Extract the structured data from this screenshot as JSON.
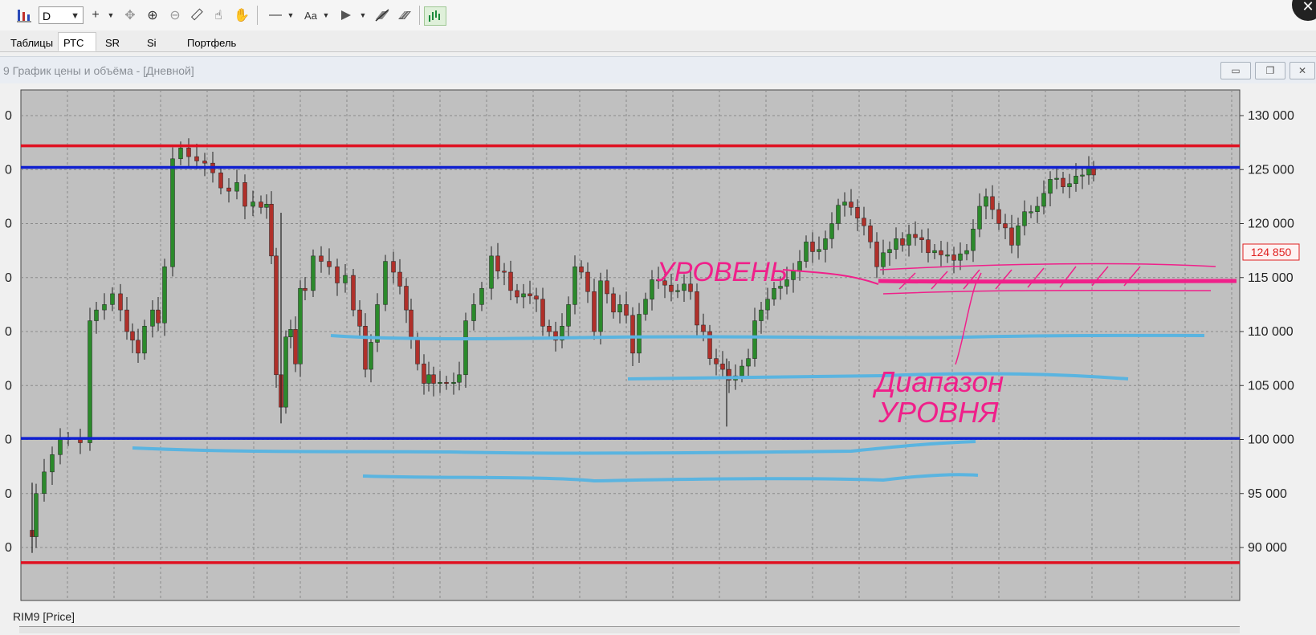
{
  "toolbar": {
    "period_value": "D",
    "buttons": [
      {
        "name": "chart-type-icon",
        "glyph": "▮"
      },
      {
        "name": "crosshair-icon",
        "glyph": "+"
      },
      {
        "name": "move-icon",
        "glyph": "✥"
      },
      {
        "name": "zoom-in-icon",
        "glyph": "⊕"
      },
      {
        "name": "zoom-out-icon",
        "glyph": "⊖"
      },
      {
        "name": "ruler-icon",
        "glyph": "📏"
      },
      {
        "name": "hand-cursor-icon",
        "glyph": "☝"
      },
      {
        "name": "pan-hand-icon",
        "glyph": "✋"
      },
      {
        "name": "line-tool-icon",
        "glyph": "—"
      },
      {
        "name": "text-tool-icon",
        "glyph": "Aa"
      },
      {
        "name": "marker-icon",
        "glyph": "◆"
      },
      {
        "name": "eraser-icon",
        "glyph": "⌫"
      },
      {
        "name": "clear-drawings-icon",
        "glyph": "▦"
      },
      {
        "name": "indicator-icon",
        "glyph": "▟"
      }
    ]
  },
  "tabs": [
    {
      "label": "Таблицы",
      "active": false
    },
    {
      "label": "РТС",
      "active": true
    },
    {
      "label": "SR",
      "active": false
    },
    {
      "label": "Si",
      "active": false
    },
    {
      "label": "Портфель",
      "active": false
    }
  ],
  "window": {
    "title": "9 График цены и объёма - [Дневной]",
    "minimize": "▭",
    "maximize": "❐",
    "close": "✕"
  },
  "chart": {
    "instrument_label": "RIM9 [Price]",
    "current_price_label": "124 850",
    "y_ticks": [
      "130 000",
      "125 000",
      "120 000",
      "115 000",
      "110 000",
      "105 000",
      "100 000",
      "95 000",
      "90 000"
    ],
    "left_tick_fragments": [
      "0",
      "0",
      "0",
      "0",
      "0",
      "0",
      "0",
      "0",
      "0"
    ],
    "annotations": {
      "level_text": "УРОВЕНЬ",
      "range_text_line1": "Диапазон",
      "range_text_line2": "УРОВНЯ"
    },
    "colors": {
      "red_level": "#e01020",
      "blue_level": "#1020d0",
      "light_blue_level": "#5ab4e0",
      "annotation": "#f0208a",
      "price_tag": "#e02020",
      "plot_bg": "#c0c0c0",
      "bull_candle": "#2b8a2b",
      "bear_candle": "#b0302a"
    }
  },
  "chart_data": {
    "type": "candlestick",
    "title": "",
    "ylim": [
      87000,
      131000
    ],
    "y_ticks": [
      90000,
      95000,
      100000,
      105000,
      110000,
      115000,
      120000,
      125000,
      130000
    ],
    "current_price": 124850,
    "horizontal_levels": [
      {
        "value": 127200,
        "color": "red"
      },
      {
        "value": 125200,
        "color": "blue"
      },
      {
        "value": 100100,
        "color": "blue"
      },
      {
        "value": 88600,
        "color": "red"
      }
    ],
    "candles_close_trace": [
      [
        40,
        91000
      ],
      [
        45,
        95000
      ],
      [
        55,
        97000
      ],
      [
        65,
        98600
      ],
      [
        75,
        100000
      ],
      [
        85,
        100100
      ],
      [
        100,
        99700
      ],
      [
        112,
        111000
      ],
      [
        120,
        112000
      ],
      [
        130,
        112500
      ],
      [
        140,
        113500
      ],
      [
        150,
        112000
      ],
      [
        158,
        110000
      ],
      [
        165,
        109200
      ],
      [
        172,
        108000
      ],
      [
        180,
        110500
      ],
      [
        190,
        112000
      ],
      [
        197,
        110800
      ],
      [
        205,
        116000
      ],
      [
        215,
        126000
      ],
      [
        225,
        127000
      ],
      [
        235,
        126200
      ],
      [
        245,
        125800
      ],
      [
        255,
        125600
      ],
      [
        265,
        124700
      ],
      [
        275,
        123300
      ],
      [
        285,
        123000
      ],
      [
        295,
        123800
      ],
      [
        305,
        121600
      ],
      [
        315,
        122000
      ],
      [
        325,
        121500
      ],
      [
        332,
        121800
      ],
      [
        338,
        117000
      ],
      [
        344,
        106000
      ],
      [
        350,
        103000
      ],
      [
        356,
        109500
      ],
      [
        362,
        110200
      ],
      [
        368,
        107000
      ],
      [
        374,
        114000
      ],
      [
        380,
        113800
      ],
      [
        390,
        117000
      ],
      [
        400,
        116500
      ],
      [
        410,
        116000
      ],
      [
        420,
        114500
      ],
      [
        430,
        115200
      ],
      [
        440,
        112000
      ],
      [
        448,
        110500
      ],
      [
        455,
        106500
      ],
      [
        462,
        109000
      ],
      [
        470,
        112500
      ],
      [
        480,
        116500
      ],
      [
        490,
        115500
      ],
      [
        498,
        114200
      ],
      [
        506,
        112000
      ],
      [
        512,
        109300
      ],
      [
        520,
        107000
      ],
      [
        528,
        105200
      ],
      [
        534,
        106000
      ],
      [
        540,
        105200
      ],
      [
        548,
        105300
      ],
      [
        556,
        105200
      ],
      [
        565,
        105300
      ],
      [
        572,
        106000
      ],
      [
        580,
        111000
      ],
      [
        590,
        112500
      ],
      [
        600,
        114000
      ],
      [
        612,
        117000
      ],
      [
        620,
        115600
      ],
      [
        628,
        115500
      ],
      [
        636,
        113800
      ],
      [
        644,
        113200
      ],
      [
        652,
        113500
      ],
      [
        660,
        113300
      ],
      [
        668,
        113000
      ],
      [
        676,
        110500
      ],
      [
        684,
        110000
      ],
      [
        692,
        109200
      ],
      [
        700,
        110500
      ],
      [
        708,
        112500
      ],
      [
        716,
        116000
      ],
      [
        724,
        115500
      ],
      [
        732,
        113700
      ],
      [
        740,
        110000
      ],
      [
        748,
        114700
      ],
      [
        756,
        113500
      ],
      [
        764,
        111800
      ],
      [
        772,
        112500
      ],
      [
        780,
        111500
      ],
      [
        788,
        108000
      ],
      [
        796,
        111600
      ],
      [
        804,
        113000
      ],
      [
        812,
        114800
      ],
      [
        820,
        114700
      ],
      [
        828,
        114300
      ],
      [
        836,
        113700
      ],
      [
        844,
        113800
      ],
      [
        852,
        114400
      ],
      [
        860,
        113700
      ],
      [
        868,
        110600
      ],
      [
        876,
        110000
      ],
      [
        884,
        107500
      ],
      [
        892,
        107000
      ],
      [
        900,
        106500
      ],
      [
        908,
        105500
      ],
      [
        916,
        105900
      ],
      [
        924,
        106800
      ],
      [
        932,
        107500
      ],
      [
        940,
        111000
      ],
      [
        948,
        112000
      ],
      [
        956,
        113000
      ],
      [
        964,
        114000
      ],
      [
        972,
        114200
      ],
      [
        980,
        114800
      ],
      [
        988,
        115600
      ],
      [
        996,
        116500
      ],
      [
        1004,
        118300
      ],
      [
        1012,
        117400
      ],
      [
        1020,
        117600
      ],
      [
        1028,
        118600
      ],
      [
        1036,
        120000
      ],
      [
        1044,
        121700
      ],
      [
        1052,
        122000
      ],
      [
        1060,
        121500
      ],
      [
        1068,
        120500
      ],
      [
        1076,
        119800
      ],
      [
        1084,
        118300
      ],
      [
        1092,
        116000
      ],
      [
        1100,
        117300
      ],
      [
        1108,
        117600
      ],
      [
        1116,
        118600
      ],
      [
        1124,
        118000
      ],
      [
        1132,
        119000
      ],
      [
        1140,
        118700
      ],
      [
        1148,
        118500
      ],
      [
        1156,
        117300
      ],
      [
        1164,
        117500
      ],
      [
        1172,
        117100
      ],
      [
        1180,
        117100
      ],
      [
        1188,
        116600
      ],
      [
        1196,
        117200
      ],
      [
        1204,
        117500
      ],
      [
        1212,
        119500
      ],
      [
        1220,
        121600
      ],
      [
        1228,
        122500
      ],
      [
        1236,
        121300
      ],
      [
        1244,
        120000
      ],
      [
        1252,
        119600
      ],
      [
        1260,
        118000
      ],
      [
        1268,
        119800
      ],
      [
        1276,
        121100
      ],
      [
        1284,
        121100
      ],
      [
        1292,
        121600
      ],
      [
        1300,
        122800
      ],
      [
        1308,
        124100
      ],
      [
        1316,
        124200
      ],
      [
        1324,
        123400
      ],
      [
        1332,
        123700
      ],
      [
        1340,
        124400
      ],
      [
        1348,
        124500
      ],
      [
        1356,
        125200
      ],
      [
        1362,
        124500
      ]
    ]
  }
}
